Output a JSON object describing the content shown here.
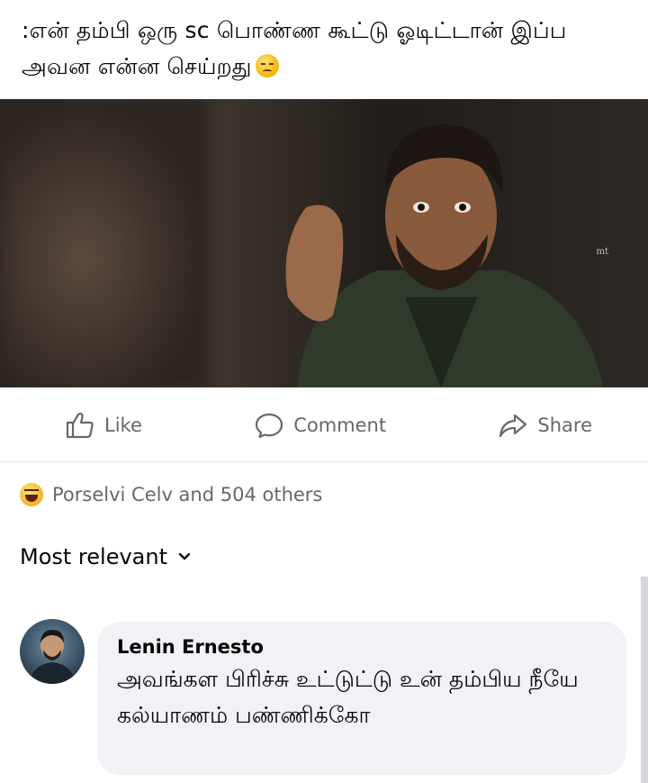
{
  "post": {
    "caption": ":என் தம்பி ஒரு sc பொண்ண கூட்டு ஓடிட்டான் இப்ப அவன என்ன செய்றது",
    "caption_emoji": "sad-face-emoji",
    "photo": {
      "watermark": "mt"
    }
  },
  "actions": {
    "like_label": "Like",
    "comment_label": "Comment",
    "share_label": "Share"
  },
  "reactions": {
    "icon": "haha-reaction-icon",
    "summary": "Porselvi Celv and 504 others"
  },
  "comments_sort": {
    "label": "Most relevant"
  },
  "comment": {
    "author": "Lenin Ernesto",
    "text": "அவங்கள பிரிச்சு உட்டுட்டு உன் தம்பிய நீயே கல்யாணம் பண்ணிக்கோ"
  },
  "colors": {
    "secondary_text": "#65676b",
    "bubble_bg": "#f0f2f5",
    "divider": "#e4e6eb"
  }
}
